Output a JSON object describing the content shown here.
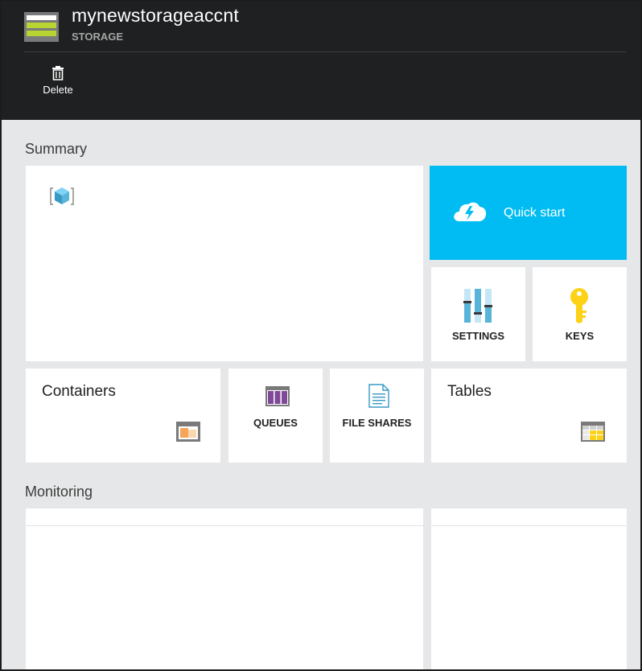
{
  "header": {
    "title": "mynewstorageaccnt",
    "subtitle": "STORAGE",
    "delete_label": "Delete"
  },
  "summary": {
    "title": "Summary",
    "quick_start_label": "Quick start",
    "settings_label": "SETTINGS",
    "keys_label": "KEYS",
    "containers_label": "Containers",
    "queues_label": "QUEUES",
    "file_shares_label": "FILE SHARES",
    "tables_label": "Tables"
  },
  "monitoring": {
    "title": "Monitoring"
  },
  "colors": {
    "header_bg": "#1f2021",
    "accent": "#00bcf2",
    "page_bg": "#e6e7e8",
    "storage_green": "#b8d432"
  }
}
